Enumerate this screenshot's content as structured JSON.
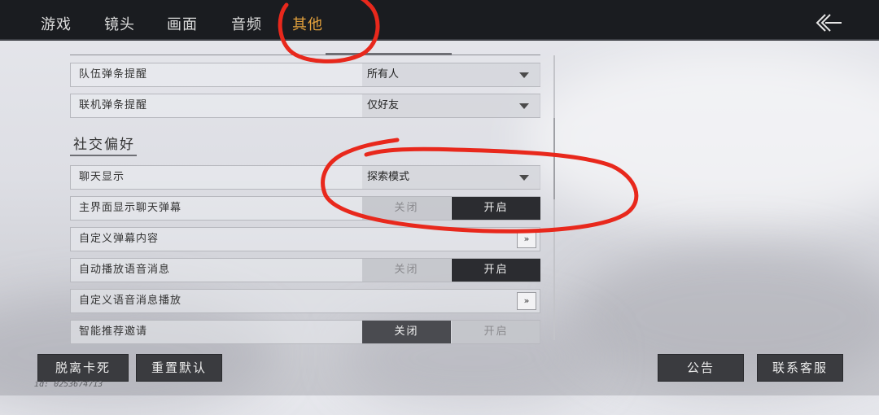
{
  "tabs": [
    {
      "label": "游戏"
    },
    {
      "label": "镜头"
    },
    {
      "label": "画面"
    },
    {
      "label": "音频"
    },
    {
      "label": "其他",
      "active": true
    }
  ],
  "back_icon": "back-arrow-icon",
  "rows_top": [
    {
      "label": "队伍弹条提醒",
      "value": "所有人"
    },
    {
      "label": "联机弹条提醒",
      "value": "仅好友"
    }
  ],
  "section": {
    "title": "社交偏好"
  },
  "rows_social": {
    "chat_display": {
      "label": "聊天显示",
      "value": "探索模式"
    },
    "main_chat_barrage": {
      "label": "主界面显示聊天弹幕",
      "off_label": "关闭",
      "on_label": "开启",
      "state": "on"
    },
    "custom_barrage": {
      "label": "自定义弹幕内容",
      "button": "»"
    },
    "auto_voice": {
      "label": "自动播放语音消息",
      "off_label": "关闭",
      "on_label": "开启",
      "state": "on"
    },
    "custom_voice": {
      "label": "自定义语音消息播放",
      "button": "»"
    },
    "smart_invite": {
      "label": "智能推荐邀请",
      "off_label": "关闭",
      "on_label": "开启",
      "state": "off"
    }
  },
  "footer": {
    "unstuck": "脱离卡死",
    "reset": "重置默认",
    "notice": "公告",
    "support": "联系客服",
    "id_text": "id: 0253674713"
  },
  "colors": {
    "active_tab": "#e3a13c",
    "annotation": "#e8281c"
  }
}
